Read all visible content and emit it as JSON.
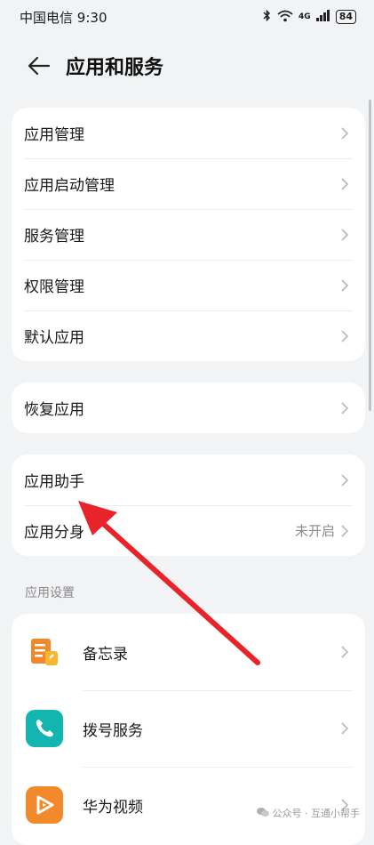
{
  "status_bar": {
    "carrier": "中国电信",
    "time": "9:30",
    "network": "4G",
    "battery": "84"
  },
  "header": {
    "title": "应用和服务"
  },
  "group1": [
    {
      "label": "应用管理"
    },
    {
      "label": "应用启动管理"
    },
    {
      "label": "服务管理"
    },
    {
      "label": "权限管理"
    },
    {
      "label": "默认应用"
    }
  ],
  "group2": [
    {
      "label": "恢复应用"
    }
  ],
  "group3": [
    {
      "label": "应用助手"
    },
    {
      "label": "应用分身",
      "value": "未开启"
    }
  ],
  "section_app_settings": "应用设置",
  "apps": [
    {
      "label": "备忘录",
      "icon": "notes-icon",
      "color": "#f0892b"
    },
    {
      "label": "拨号服务",
      "icon": "phone-icon",
      "color": "#12b5b0"
    },
    {
      "label": "华为视频",
      "icon": "video-icon",
      "color": "#f2892a"
    }
  ],
  "watermark": "公众号 · 互通小帮手",
  "annotation_color": "#e8232a"
}
